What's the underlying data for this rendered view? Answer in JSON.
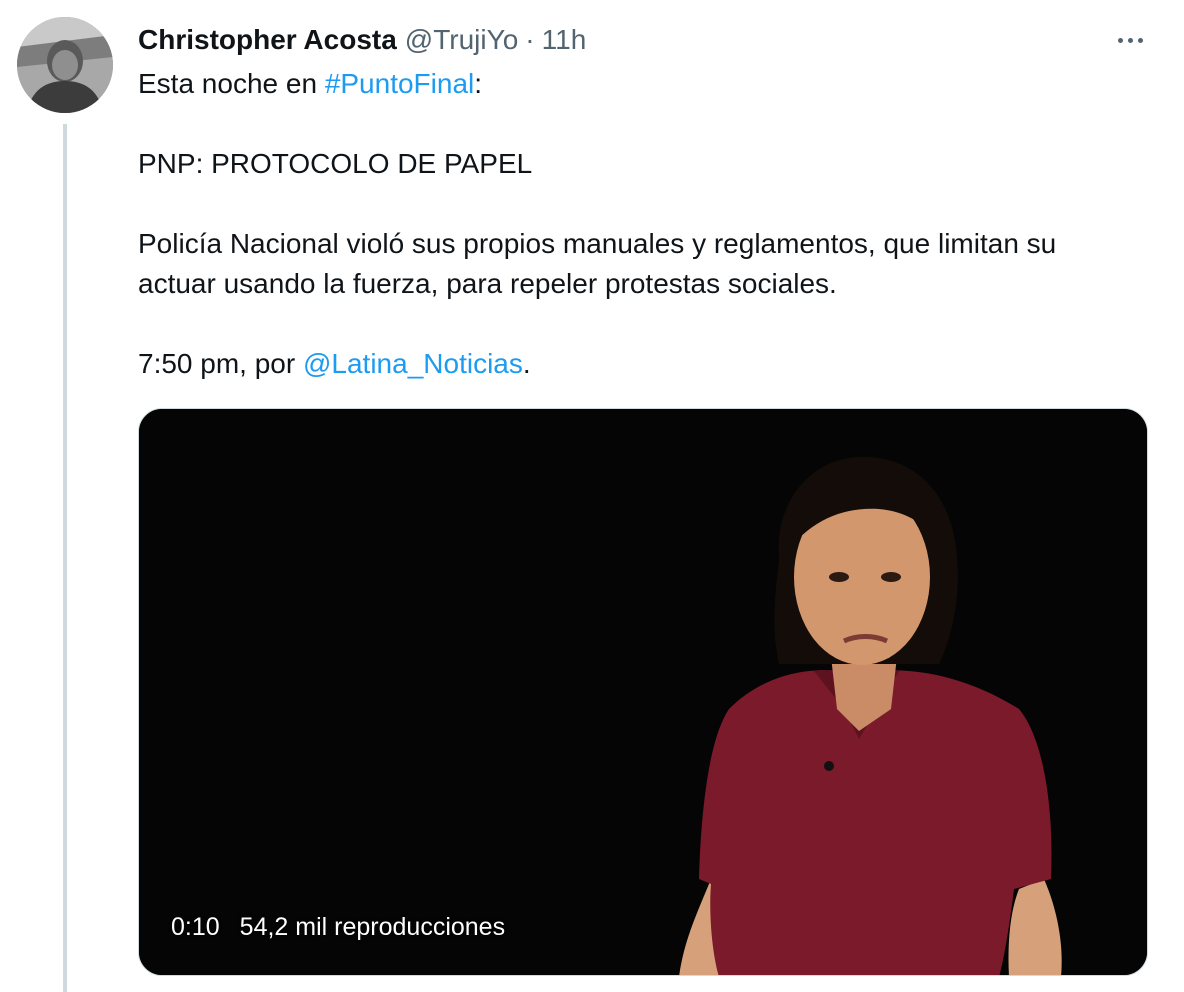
{
  "tweet": {
    "author_name": "Christopher Acosta",
    "handle": "@TrujiYo",
    "separator": "·",
    "time": "11h",
    "more_icon": "more-horizontal-icon",
    "text": {
      "line1_prefix": "Esta noche en ",
      "line1_hashtag": "#PuntoFinal",
      "line1_suffix": ":",
      "line2": "PNP: PROTOCOLO DE PAPEL",
      "line3": "Policía Nacional violó sus propios manuales y reglamentos, que limitan su actuar usando la fuerza, para repeler protestas sociales.",
      "line4_prefix": "7:50 pm, por ",
      "line4_mention": "@Latina_Noticias",
      "line4_suffix": "."
    },
    "video": {
      "duration": "0:10",
      "views": "54,2 mil reproducciones"
    }
  },
  "colors": {
    "link": "#1d9bf0",
    "secondary_text": "#536471",
    "shirt": "#7a1a2a",
    "thread_line": "#cfd9de"
  }
}
